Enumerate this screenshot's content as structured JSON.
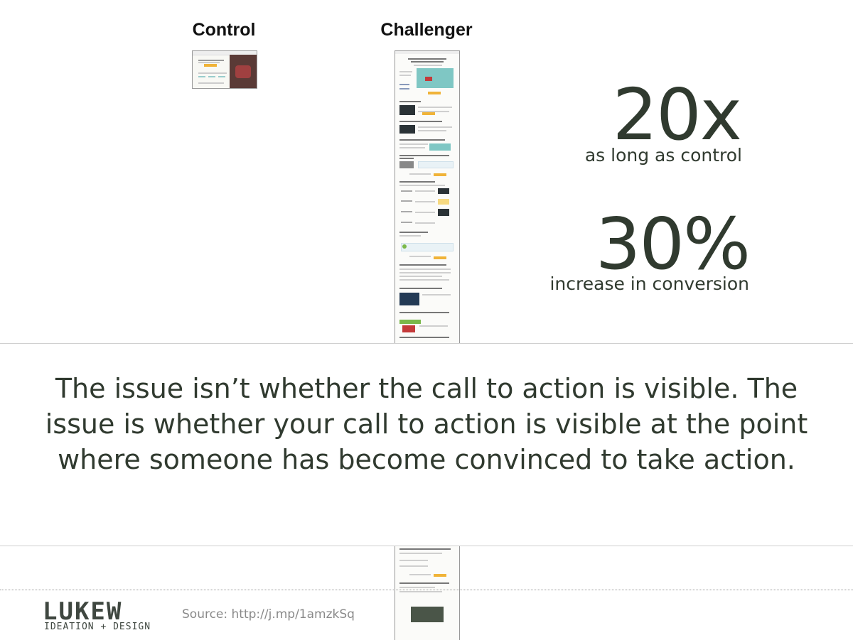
{
  "columns": {
    "control_label": "Control",
    "challenger_label": "Challenger"
  },
  "stats": [
    {
      "value": "20x",
      "caption": "as long as control"
    },
    {
      "value": "30%",
      "caption": "increase in conversion"
    }
  ],
  "quote": "The issue isn’t whether the call to action is visible. The issue is whether your call to action is visible at the point where someone has become convinced to take action.",
  "footer": {
    "logo_main": "LUKEW",
    "logo_sub": "IDEATION + DESIGN",
    "source": "Source: http://j.mp/1amzkSq"
  },
  "colors": {
    "text": "#303a2f",
    "cta": "#f0b338"
  }
}
